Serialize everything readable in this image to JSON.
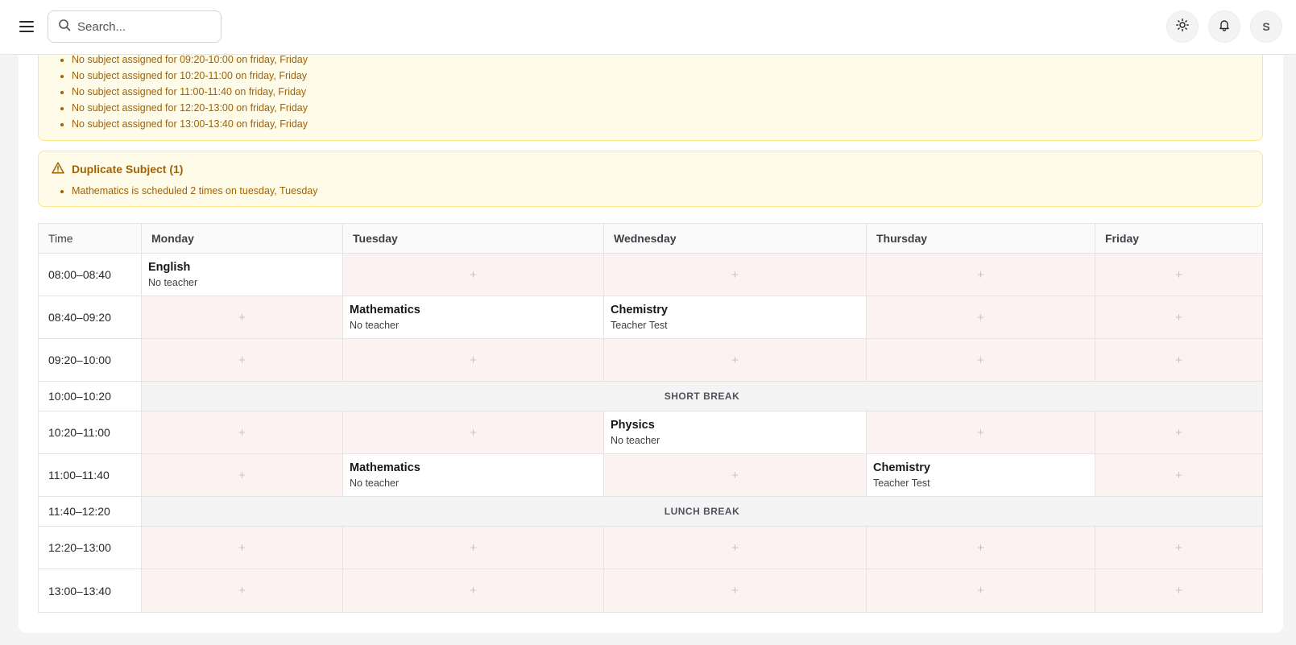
{
  "header": {
    "search_placeholder": "Search...",
    "avatar_initial": "S",
    "icons": {
      "menu": "hamburger-menu-icon",
      "search": "search-icon",
      "theme": "sun-icon",
      "notifications": "bell-icon"
    }
  },
  "alerts": {
    "missing": {
      "items": [
        "No subject assigned for 09:20-10:00 on friday, Friday",
        "No subject assigned for 10:20-11:00 on friday, Friday",
        "No subject assigned for 11:00-11:40 on friday, Friday",
        "No subject assigned for 12:20-13:00 on friday, Friday",
        "No subject assigned for 13:00-13:40 on friday, Friday"
      ]
    },
    "duplicate": {
      "title": "Duplicate Subject (1)",
      "items": [
        "Mathematics is scheduled 2 times on tuesday, Tuesday"
      ]
    }
  },
  "timetable": {
    "headers": [
      "Time",
      "Monday",
      "Tuesday",
      "Wednesday",
      "Thursday",
      "Friday"
    ],
    "empty_symbol": "+",
    "rows": [
      {
        "time": "08:00–08:40",
        "cells": [
          {
            "subject": "English",
            "teacher": "No teacher"
          },
          null,
          null,
          null,
          null
        ]
      },
      {
        "time": "08:40–09:20",
        "cells": [
          null,
          {
            "subject": "Mathematics",
            "teacher": "No teacher"
          },
          {
            "subject": "Chemistry",
            "teacher": "Teacher Test"
          },
          null,
          null
        ]
      },
      {
        "time": "09:20–10:00",
        "cells": [
          null,
          null,
          null,
          null,
          null
        ]
      },
      {
        "time": "10:00–10:20",
        "break": "SHORT BREAK"
      },
      {
        "time": "10:20–11:00",
        "cells": [
          null,
          null,
          {
            "subject": "Physics",
            "teacher": "No teacher"
          },
          null,
          null
        ]
      },
      {
        "time": "11:00–11:40",
        "cells": [
          null,
          {
            "subject": "Mathematics",
            "teacher": "No teacher"
          },
          null,
          {
            "subject": "Chemistry",
            "teacher": "Teacher Test"
          },
          null
        ]
      },
      {
        "time": "11:40–12:20",
        "break": "LUNCH BREAK"
      },
      {
        "time": "12:20–13:00",
        "cells": [
          null,
          null,
          null,
          null,
          null
        ]
      },
      {
        "time": "13:00–13:40",
        "cells": [
          null,
          null,
          null,
          null,
          null
        ]
      }
    ]
  }
}
